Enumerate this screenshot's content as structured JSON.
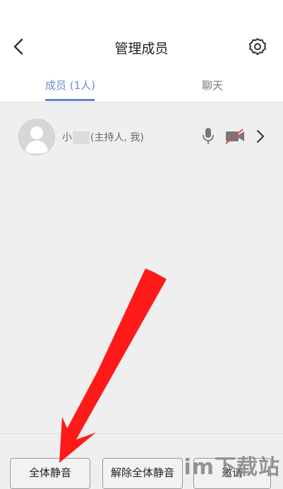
{
  "header": {
    "title": "管理成员"
  },
  "tabs": {
    "members_label": "成员 (1人)",
    "chat_label": "聊天"
  },
  "member": {
    "name_prefix": "小",
    "role_suffix": "(主持人, 我)"
  },
  "icons": {
    "back": "chevron-left-icon",
    "settings": "gear-icon",
    "mic": "microphone-icon",
    "camera_off": "video-off-icon",
    "detail": "chevron-right-icon"
  },
  "bottom_buttons": {
    "mute_all": "全体静音",
    "unmute_all": "解除全体静音",
    "invite": "邀请"
  },
  "watermark": "im下载站",
  "colors": {
    "accent": "#5b86d6",
    "arrow": "#ff1a1a"
  }
}
